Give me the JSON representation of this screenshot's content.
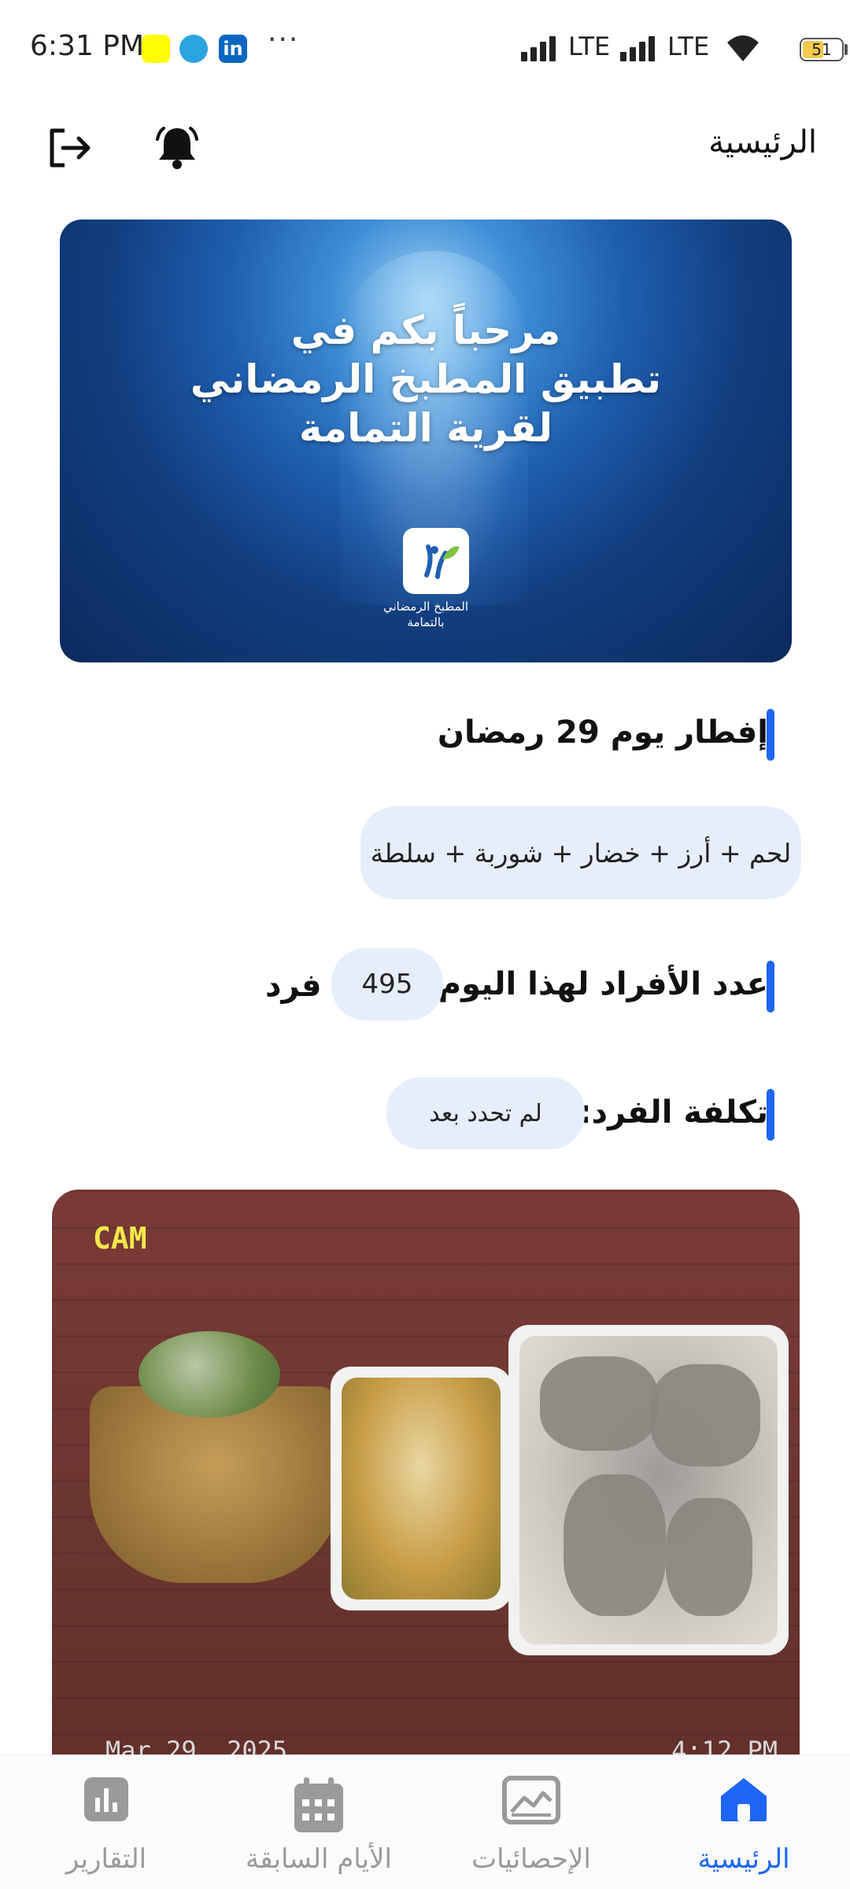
{
  "status_bar": {
    "time": "6:31 PM",
    "network1": "LTE",
    "network2": "LTE",
    "battery": "51",
    "linkedin_glyph": "in",
    "more_glyph": "···"
  },
  "header": {
    "title": "الرئيسية",
    "logout_icon": "logout-icon",
    "bell_icon": "bell-icon"
  },
  "banner": {
    "line1": "مرحباً بكم في",
    "line2": "تطبيق المطبخ الرمضاني",
    "line3": "لقرية التمامة",
    "logo_caption1": "المطبخ الرمضاني",
    "logo_caption2": "بالتمامة"
  },
  "iftar": {
    "title": "إفطار يوم 29 رمضان",
    "menu": "لحم + أرز + خضار + شوربة + سلطة"
  },
  "count": {
    "label": "عدد الأفراد لهذا اليوم:",
    "value": "495",
    "unit": "فرد"
  },
  "cost": {
    "label": "تكلفة الفرد:",
    "value": "لم تحدد بعد"
  },
  "photo": {
    "cam_label": "CAM",
    "date": "Mar 29, 2025",
    "time": "4:12 PM"
  },
  "bottom_nav": {
    "items": [
      {
        "label": "التقارير",
        "icon": "bar-chart-icon"
      },
      {
        "label": "الأيام السابقة",
        "icon": "calendar-icon"
      },
      {
        "label": "الإحصائيات",
        "icon": "image-chart-icon"
      },
      {
        "label": "الرئيسية",
        "icon": "home-icon",
        "active": true
      }
    ]
  },
  "colors": {
    "accent": "#1E66F5",
    "pill_bg": "#E6EEFB",
    "inactive": "#9A9A9A"
  }
}
